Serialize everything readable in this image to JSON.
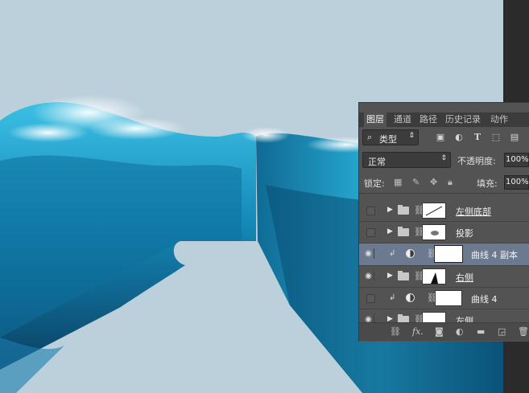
{
  "panel": {
    "tabs": [
      "图层",
      "通道",
      "路径",
      "历史记录",
      "动作"
    ],
    "filter": {
      "label": "类型",
      "search_icon": "search-icon"
    },
    "filter_tools": [
      "image-filter-icon",
      "adjustment-filter-icon",
      "type-filter-icon",
      "shape-filter-icon",
      "smart-object-filter-icon"
    ],
    "blend_mode": "正常",
    "opacity_label": "不透明度:",
    "opacity_value": "100%",
    "lock_label": "锁定:",
    "fill_label": "填充:",
    "fill_value": "100%",
    "layers": [
      {
        "name": "左侧底部",
        "type": "group",
        "visible": false,
        "selected": false
      },
      {
        "name": "投影",
        "type": "group",
        "visible": false,
        "selected": false
      },
      {
        "name": "曲线 4 副本",
        "type": "adjustment",
        "visible": true,
        "selected": true
      },
      {
        "name": "右侧",
        "type": "group",
        "visible": true,
        "selected": false
      },
      {
        "name": "曲线 4",
        "type": "adjustment",
        "visible": false,
        "selected": false
      },
      {
        "name": "左侧",
        "type": "group",
        "visible": true,
        "selected": false
      }
    ],
    "bottom_icons": [
      "link-icon",
      "fx-icon",
      "mask-icon",
      "adjustment-icon",
      "new-group-icon",
      "new-layer-icon",
      "trash-icon"
    ],
    "bottom_fx": "fx."
  },
  "colors": {
    "sky": "#bcd0dc",
    "wave_dark": "#0b5f86",
    "wave_light": "#2aa8d2",
    "panel": "#535353",
    "selected": "#6b7a91"
  }
}
